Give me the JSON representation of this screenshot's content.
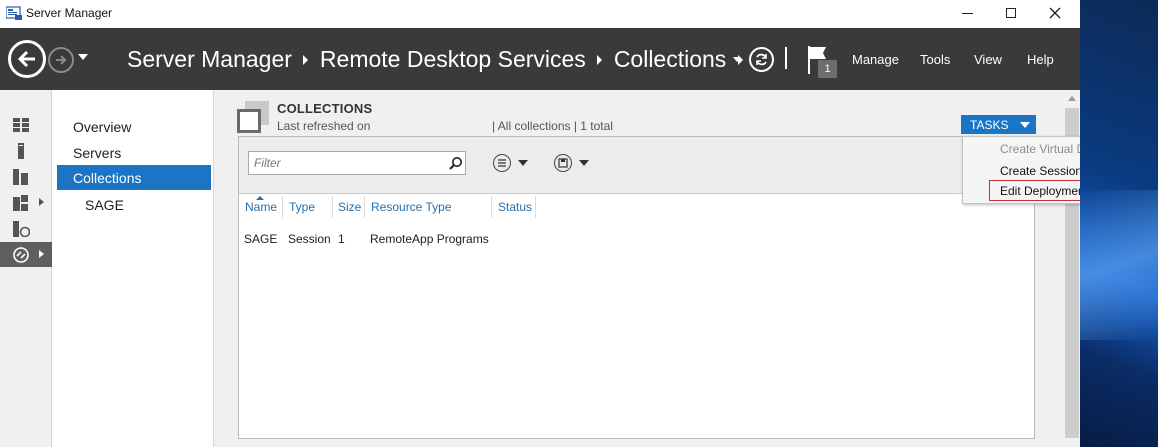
{
  "window": {
    "title": "Server Manager",
    "controls": [
      "minimize",
      "maximize",
      "close"
    ]
  },
  "header": {
    "breadcrumb": [
      "Server Manager",
      "Remote Desktop Services",
      "Collections"
    ],
    "notification_count": "1",
    "menu": [
      "Manage",
      "Tools",
      "View",
      "Help"
    ]
  },
  "rail": {
    "items": [
      {
        "icon": "dashboard-icon"
      },
      {
        "icon": "local-server-icon"
      },
      {
        "icon": "all-servers-icon"
      },
      {
        "icon": "file-storage-icon",
        "expandable": true
      },
      {
        "icon": "iis-icon"
      },
      {
        "icon": "remote-desktop-services-icon",
        "expandable": true,
        "active": true
      }
    ]
  },
  "nav": {
    "items": [
      {
        "label": "Overview"
      },
      {
        "label": "Servers"
      },
      {
        "label": "Collections",
        "selected": true
      },
      {
        "label": "SAGE",
        "sub": true
      }
    ]
  },
  "section": {
    "title": "COLLECTIONS",
    "subtitle": "Last refreshed on",
    "summary": "| All collections  | 1 total",
    "tasks_label": "TASKS"
  },
  "filter": {
    "placeholder": "Filter"
  },
  "table": {
    "columns": [
      "Name",
      "Type",
      "Size",
      "Resource Type",
      "Status"
    ],
    "rows": [
      [
        "SAGE",
        "Session",
        "1",
        "RemoteApp Programs",
        ""
      ]
    ]
  },
  "tasks_menu": {
    "items": [
      {
        "label": "Create Virtual Desktop Collection",
        "disabled": true
      },
      {
        "label": "Create Session Collection"
      },
      {
        "label": "Edit Deployment Properties",
        "highlighted": true
      }
    ]
  },
  "colors": {
    "header_bg": "#3a3a3a",
    "accent": "#1c75c4",
    "highlight_border": "#c83232"
  }
}
